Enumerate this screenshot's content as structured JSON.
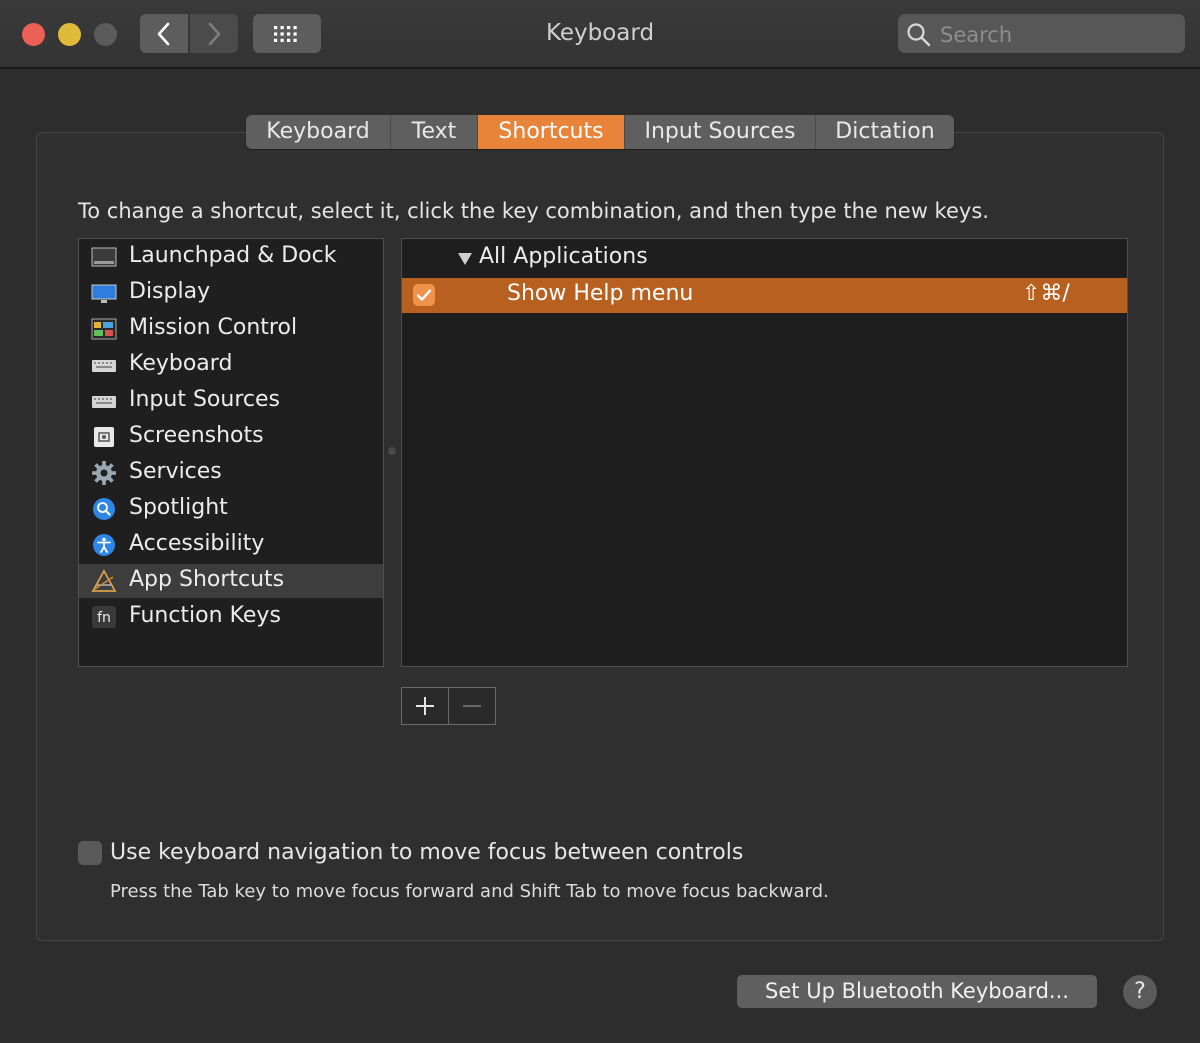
{
  "window": {
    "title": "Keyboard"
  },
  "toolbar": {
    "search_placeholder": "Search"
  },
  "tabs": [
    {
      "label": "Keyboard",
      "active": false
    },
    {
      "label": "Text",
      "active": false
    },
    {
      "label": "Shortcuts",
      "active": true
    },
    {
      "label": "Input Sources",
      "active": false
    },
    {
      "label": "Dictation",
      "active": false
    }
  ],
  "instruction": "To change a shortcut, select it, click the key combination, and then type the new keys.",
  "categories": [
    {
      "label": "Launchpad & Dock",
      "icon": "launchpad-dock-icon"
    },
    {
      "label": "Display",
      "icon": "display-icon"
    },
    {
      "label": "Mission Control",
      "icon": "mission-control-icon"
    },
    {
      "label": "Keyboard",
      "icon": "keyboard-icon"
    },
    {
      "label": "Input Sources",
      "icon": "input-sources-icon"
    },
    {
      "label": "Screenshots",
      "icon": "screenshots-icon"
    },
    {
      "label": "Services",
      "icon": "gear-icon"
    },
    {
      "label": "Spotlight",
      "icon": "spotlight-icon"
    },
    {
      "label": "Accessibility",
      "icon": "accessibility-icon"
    },
    {
      "label": "App Shortcuts",
      "icon": "app-shortcuts-icon",
      "selected": true
    },
    {
      "label": "Function Keys",
      "icon": "fn-icon"
    }
  ],
  "shortcuts": {
    "group_label": "All Applications",
    "items": [
      {
        "label": "Show Help menu",
        "keys": "⇧⌘/",
        "enabled": true,
        "selected": true
      }
    ]
  },
  "add_remove": {
    "add": "+",
    "remove": "−"
  },
  "keyboard_navigation": {
    "label": "Use keyboard navigation to move focus between controls",
    "hint": "Press the Tab key to move focus forward and Shift Tab to move focus backward.",
    "checked": false
  },
  "footer": {
    "bluetooth_button": "Set Up Bluetooth Keyboard...",
    "help_button": "?"
  },
  "colors": {
    "accent": "#e8833a",
    "selection": "#b7601f",
    "background": "#2d2d2d"
  }
}
